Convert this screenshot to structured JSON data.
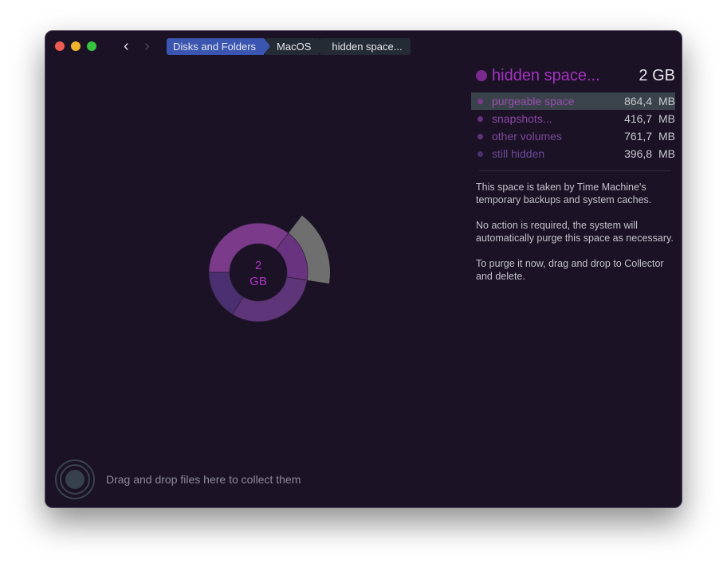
{
  "window": {
    "traffic_lights": {
      "close": "#ee5b52",
      "minimize": "#f1b32c",
      "zoom": "#37c33f"
    }
  },
  "nav": {
    "back_icon": "chevron-left",
    "forward_icon": "chevron-right"
  },
  "breadcrumb": [
    "Disks and Folders",
    "MacOS",
    "hidden space..."
  ],
  "panel": {
    "title": "hidden space...",
    "size": "2 GB",
    "color": "#7a2a8f",
    "items": [
      {
        "label": "purgeable space",
        "size": "864,4 MB",
        "mb": 864.4,
        "color": "#7b3a8a",
        "text": "#9a4fae",
        "selected": true
      },
      {
        "label": "snapshots...",
        "size": "416,7 MB",
        "mb": 416.7,
        "color": "#6a3380",
        "text": "#8a48a2",
        "selected": false
      },
      {
        "label": "other volumes",
        "size": "761,7 MB",
        "mb": 761.7,
        "color": "#5e3578",
        "text": "#7c4a98",
        "selected": false
      },
      {
        "label": "still hidden",
        "size": "396,8 MB",
        "mb": 396.8,
        "color": "#4a3070",
        "text": "#6a4a94",
        "selected": false
      }
    ],
    "description": [
      "This space is taken by Time Machine's temporary backups and system caches.",
      "No action is required, the system will automatically purge this space as necessary.",
      "To purge it now, drag and drop to Collector and delete."
    ]
  },
  "chart_data": {
    "type": "pie",
    "center_label": [
      "2",
      "GB"
    ],
    "categories": [
      "purgeable space",
      "snapshots...",
      "other volumes",
      "still hidden"
    ],
    "values": [
      864.4,
      416.7,
      761.7,
      396.8
    ],
    "unit": "MB",
    "outer_ring": [
      {
        "parent": "snapshots...",
        "color": "#6f6f6f"
      }
    ]
  },
  "collector": {
    "hint": "Drag and drop files here to collect them"
  }
}
